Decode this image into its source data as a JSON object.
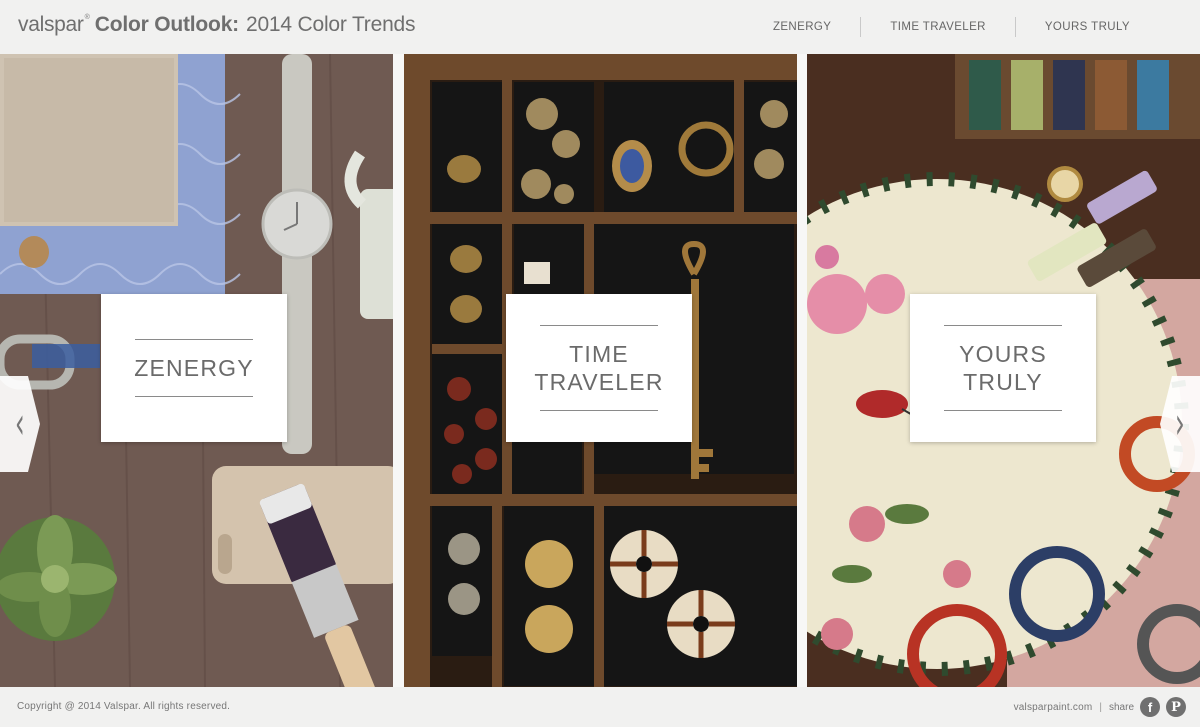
{
  "header": {
    "brand": "valspar",
    "brand_mark": "®",
    "title_bold": "Color Outlook:",
    "title_light": "2014 Color Trends",
    "nav": [
      "ZENERGY",
      "TIME TRAVELER",
      "YOURS TRULY"
    ]
  },
  "panels": [
    {
      "label": "ZENERGY"
    },
    {
      "label": "TIME\nTRAVELER"
    },
    {
      "label": "YOURS\nTRULY"
    }
  ],
  "arrows": {
    "prev": "‹",
    "next": "›",
    "prev_icon": "chevron-left-icon",
    "next_icon": "chevron-right-icon"
  },
  "footer": {
    "copyright": "Copyright @ 2014 Valspar. All rights reserved.",
    "site": "valsparpaint.com",
    "divider": "|",
    "share": "share",
    "facebook": "f",
    "pinterest": "P"
  },
  "colors": {
    "header_bg": "#f1f1f0",
    "zenergy_wood": "#6f5a52",
    "time_traveler_wood": "#3a2718",
    "yours_truly_wood": "#4a2e20",
    "card_bg": "#ffffff",
    "text_gray": "#6b6b6b"
  }
}
